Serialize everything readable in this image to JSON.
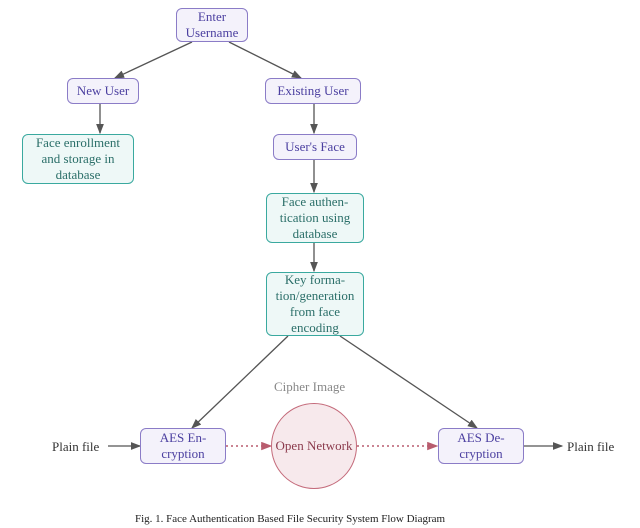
{
  "nodes": {
    "enter": "Enter Username",
    "newuser": "New User",
    "existing": "Existing User",
    "enroll": "Face enrollment and storage in database",
    "face": "User's Face",
    "auth": "Face authen-\ntication using database",
    "key": "Key forma-\ntion/generation from face encoding",
    "enc": "AES En-\ncryption",
    "dec": "AES De-\ncryption",
    "net": "Open Network"
  },
  "labels": {
    "plain_left": "Plain file",
    "plain_right": "Plain file",
    "cipher": "Cipher Image"
  },
  "caption": "Fig. 1.  Face Authentication Based File Security System Flow Diagram"
}
